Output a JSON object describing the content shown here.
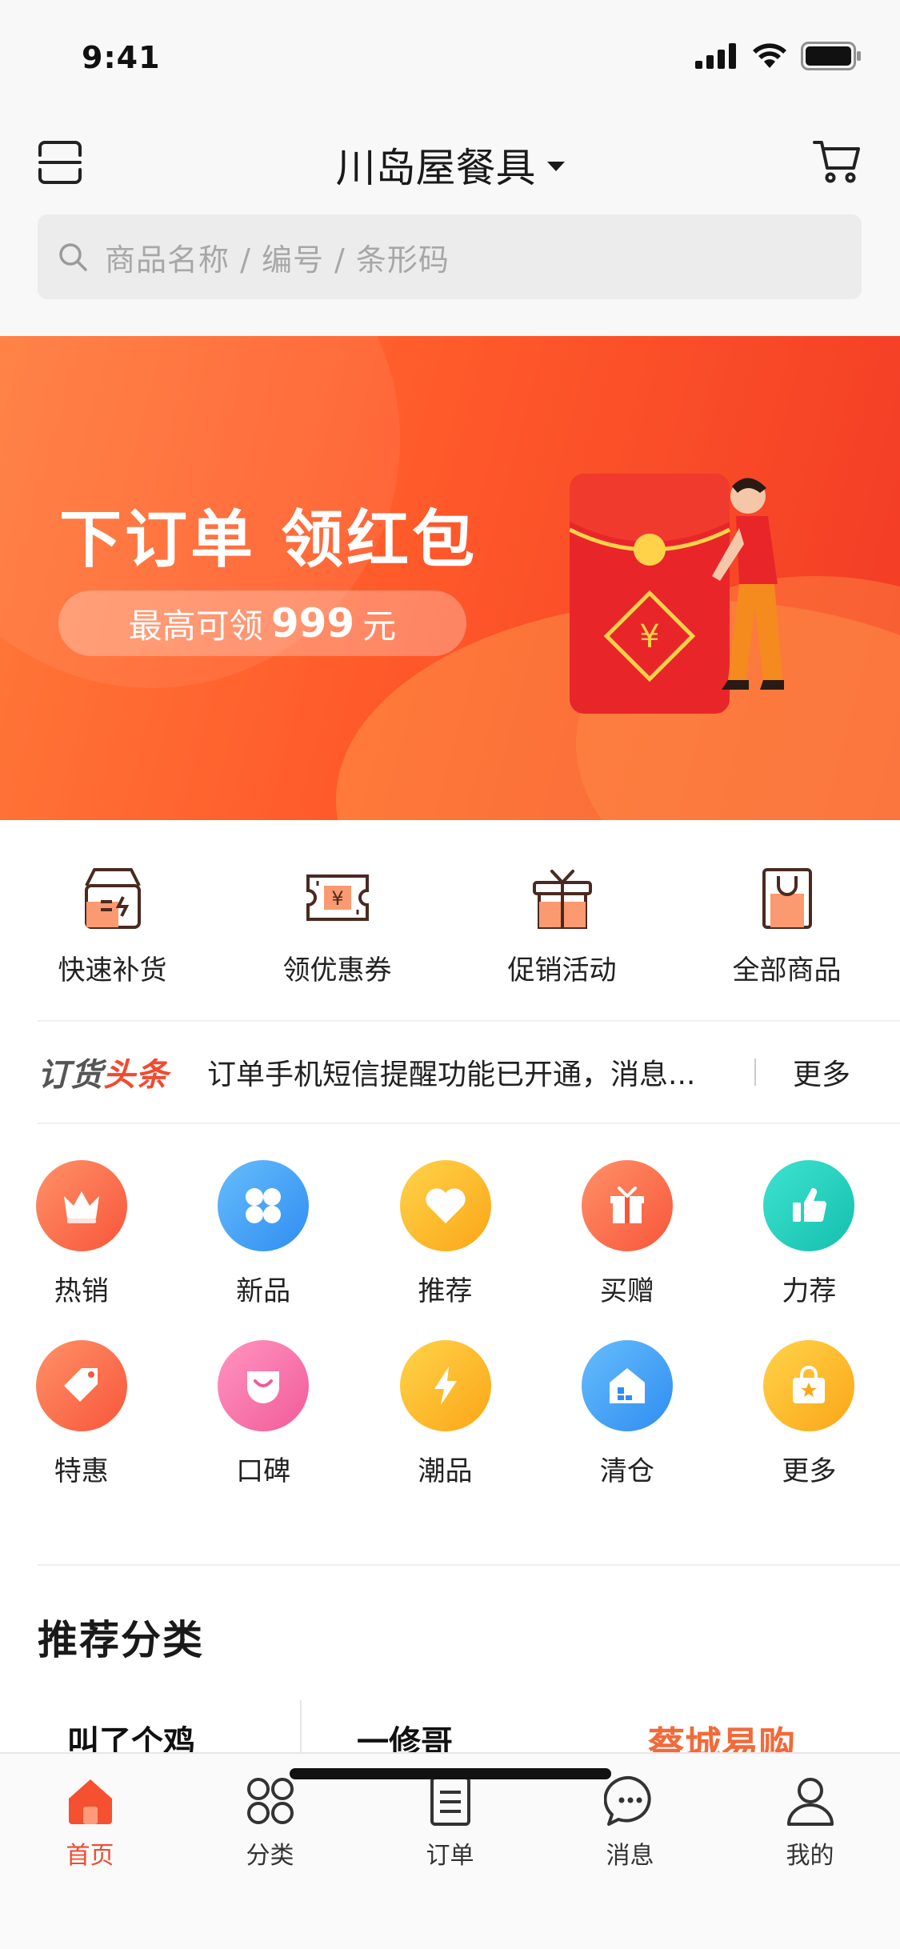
{
  "status_bar": {
    "time": "9:41"
  },
  "header": {
    "store_name": "川岛屋餐具",
    "search_placeholder": "商品名称 / 编号 / 条形码"
  },
  "banner": {
    "title": "下订单 领红包",
    "pill_prefix": "最高可领",
    "pill_amount": "999",
    "pill_unit": "元",
    "redpacket_symbol": "¥"
  },
  "quick_actions": [
    {
      "label": "快速补货",
      "icon": "box-icon"
    },
    {
      "label": "领优惠券",
      "icon": "coupon-icon"
    },
    {
      "label": "促销活动",
      "icon": "gift-icon"
    },
    {
      "label": "全部商品",
      "icon": "bag-icon"
    }
  ],
  "news": {
    "brand_part1": "订货",
    "brand_part2": "头条",
    "text": "订单手机短信提醒功能已开通，消息...",
    "more": "更多"
  },
  "categories": [
    {
      "label": "热销",
      "icon": "crown-icon",
      "color": "#fb6a4a"
    },
    {
      "label": "新品",
      "icon": "clover-icon",
      "color": "#3aa0f5"
    },
    {
      "label": "推荐",
      "icon": "heart-icon",
      "color": "#fcb81f"
    },
    {
      "label": "买赠",
      "icon": "gift-icon",
      "color": "#fb6a4a"
    },
    {
      "label": "力荐",
      "icon": "thumbs-up-icon",
      "color": "#1fcfc0"
    },
    {
      "label": "特惠",
      "icon": "tag-icon",
      "color": "#fb6a4a"
    },
    {
      "label": "口碑",
      "icon": "smile-icon",
      "color": "#f772a8"
    },
    {
      "label": "潮品",
      "icon": "lightning-icon",
      "color": "#fcb81f"
    },
    {
      "label": "清仓",
      "icon": "warehouse-icon",
      "color": "#3aa0f5"
    },
    {
      "label": "更多",
      "icon": "shopping-bag-star-icon",
      "color": "#fcb81f"
    }
  ],
  "section": {
    "title": "推荐分类"
  },
  "brands": [
    {
      "name": "叫了个鸡"
    },
    {
      "name": "一修哥"
    },
    {
      "name": "蔡城易购"
    }
  ],
  "tabbar": [
    {
      "label": "首页",
      "icon": "home-icon",
      "active": true
    },
    {
      "label": "分类",
      "icon": "grid-icon",
      "active": false
    },
    {
      "label": "订单",
      "icon": "document-icon",
      "active": false
    },
    {
      "label": "消息",
      "icon": "chat-icon",
      "active": false
    },
    {
      "label": "我的",
      "icon": "user-icon",
      "active": false
    }
  ],
  "colors": {
    "accent": "#f24a2f",
    "banner_start": "#ff7a3a",
    "banner_end": "#f23a25"
  }
}
